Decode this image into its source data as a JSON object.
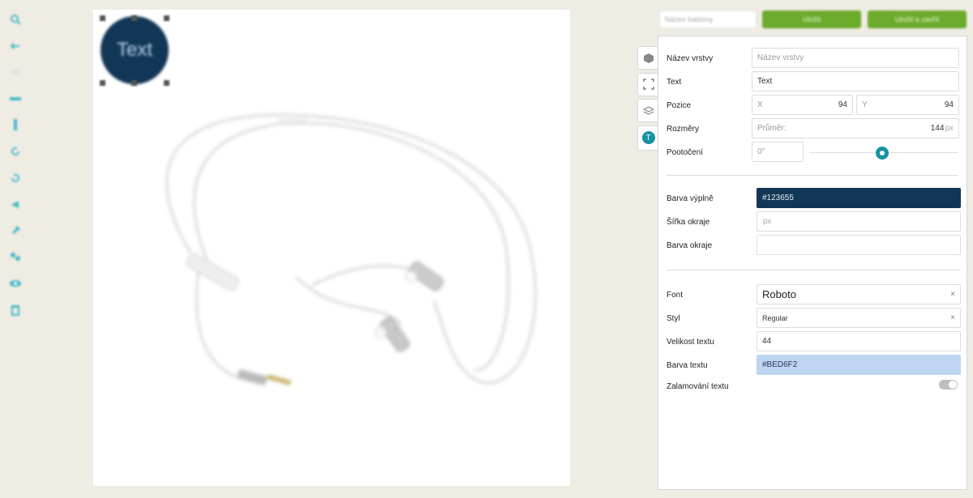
{
  "toolbar": {
    "icons": [
      "zoom-icon",
      "undo-icon",
      "redo-icon",
      "horizontal-line-icon",
      "vertical-line-icon",
      "rotate-right-icon",
      "rotate-left-icon",
      "flip-icon",
      "pin-icon",
      "link-icon",
      "eye-icon",
      "trash-icon"
    ],
    "accent": "#45b8c8"
  },
  "canvas": {
    "circle_text": "Text",
    "circle_fill": "#123655",
    "circle_text_color": "#BED6F2"
  },
  "top": {
    "template_placeholder": "Název šablony",
    "save_label": "Uložit",
    "save_as_label": "Uložit a zavřít"
  },
  "side_tabs": {
    "text_tab_label": "T"
  },
  "panel": {
    "layer_name": {
      "label": "Název vrstvy",
      "placeholder": "Název vrstvy",
      "value": ""
    },
    "text": {
      "label": "Text",
      "value": "Text"
    },
    "position": {
      "label": "Pozice",
      "x_label": "X",
      "x_value": "94",
      "y_label": "Y",
      "y_value": "94"
    },
    "size": {
      "label": "Rozměry",
      "placeholder": "Průměr:",
      "value": "144",
      "unit": "px"
    },
    "rotation": {
      "label": "Pootočení",
      "value": "0°",
      "level": 0.5
    },
    "fill_color": {
      "label": "Barva výplně",
      "value": "#123655"
    },
    "border_width": {
      "label": "Šířka okraje",
      "unit": "px"
    },
    "border_color": {
      "label": "Barva okraje"
    },
    "font": {
      "label": "Font",
      "value": "Roboto",
      "clear": "×"
    },
    "style": {
      "label": "Styl",
      "value": "Regular",
      "clear": "×"
    },
    "text_size": {
      "label": "Velikost textu",
      "value": "44"
    },
    "text_color": {
      "label": "Barva textu",
      "value": "#BED6F2"
    },
    "wrap": {
      "label": "Zalamování textu",
      "enabled": false
    }
  },
  "colors": {
    "accent": "#1593a3",
    "button_green": "#6cab2c",
    "fill_bg": "#123655",
    "text_color_bg": "#BED6F2"
  }
}
